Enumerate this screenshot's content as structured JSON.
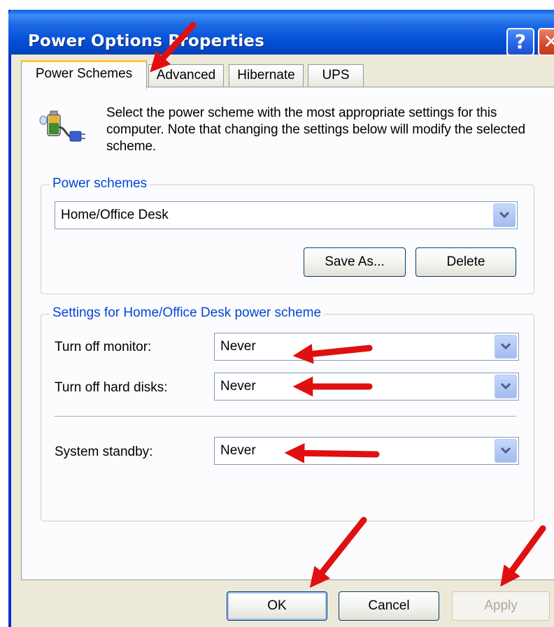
{
  "window": {
    "title": "Power Options Properties",
    "help_button": "?",
    "close_button": "✕"
  },
  "tabs": [
    {
      "label": "Power Schemes",
      "active": true
    },
    {
      "label": "Advanced",
      "active": false
    },
    {
      "label": "Hibernate",
      "active": false
    },
    {
      "label": "UPS",
      "active": false
    }
  ],
  "description": "Select the power scheme with the most appropriate settings for this computer. Note that changing the settings below will modify the selected scheme.",
  "power_schemes": {
    "legend": "Power schemes",
    "selected": "Home/Office Desk",
    "save_as_label": "Save As...",
    "delete_label": "Delete"
  },
  "settings": {
    "legend": "Settings for Home/Office Desk power scheme",
    "monitor_label": "Turn off monitor:",
    "monitor_value": "Never",
    "hard_disks_label": "Turn off hard disks:",
    "hard_disks_value": "Never",
    "standby_label": "System standby:",
    "standby_value": "Never"
  },
  "footer": {
    "ok_label": "OK",
    "cancel_label": "Cancel",
    "apply_label": "Apply"
  },
  "icons": {
    "app": "power-plug-battery-icon",
    "dropdown": "chevron-down-icon",
    "annotation": "red-arrow-icon"
  },
  "colors": {
    "titlebar": "#0350d8",
    "window_bg": "#ece9d8",
    "tab_highlight": "#ffc83c",
    "group_legend": "#0046d5",
    "annotation_arrow": "#e01010"
  }
}
